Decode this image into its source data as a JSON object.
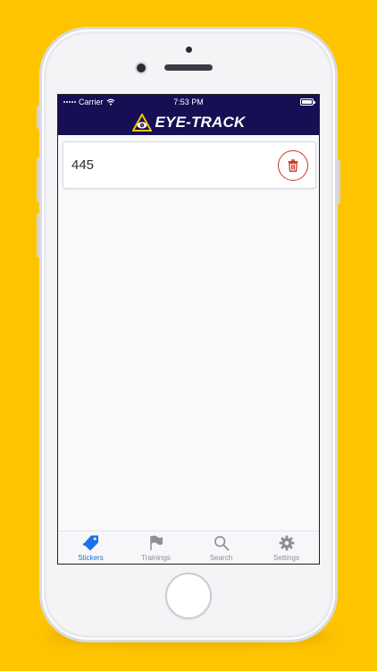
{
  "status_bar": {
    "carrier": "Carrier",
    "time": "7:53 PM",
    "battery_level": 1.0
  },
  "header": {
    "logo_text": "EYE-TRACK",
    "logo_icon": "eye-triangle-logo"
  },
  "stickers": [
    {
      "value": "445",
      "action_icon": "trash-icon"
    }
  ],
  "tabs": [
    {
      "label": "Stickers",
      "icon": "tag-icon",
      "active": true
    },
    {
      "label": "Trainings",
      "icon": "flag-icon",
      "active": false
    },
    {
      "label": "Search",
      "icon": "search-icon",
      "active": false
    },
    {
      "label": "Settings",
      "icon": "gear-icon",
      "active": false
    }
  ],
  "colors": {
    "background": "#FFC400",
    "header": "#160f54",
    "accent": "#1a73e8",
    "delete": "#d0381d"
  }
}
